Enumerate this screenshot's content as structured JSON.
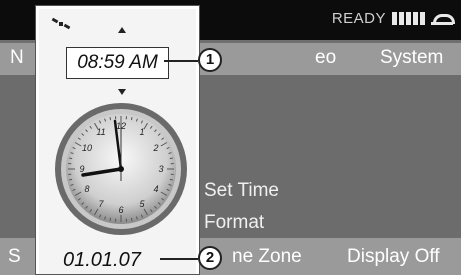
{
  "status": {
    "text": "READY"
  },
  "menu": {
    "left": "N",
    "video": "eo",
    "system": "System"
  },
  "options": {
    "set_time": "Set Time",
    "format": "Format",
    "time_zone": "ne Zone"
  },
  "bottom": {
    "left": "S",
    "display_off": "Display Off"
  },
  "panel": {
    "time": "08:59 AM",
    "date": "01.01.07"
  },
  "callouts": [
    "1",
    "2"
  ],
  "icons": [
    "satellite-icon",
    "arrow-up-icon",
    "arrow-down-icon",
    "analog-clock-icon",
    "signal-strength-icon",
    "phone-icon"
  ]
}
